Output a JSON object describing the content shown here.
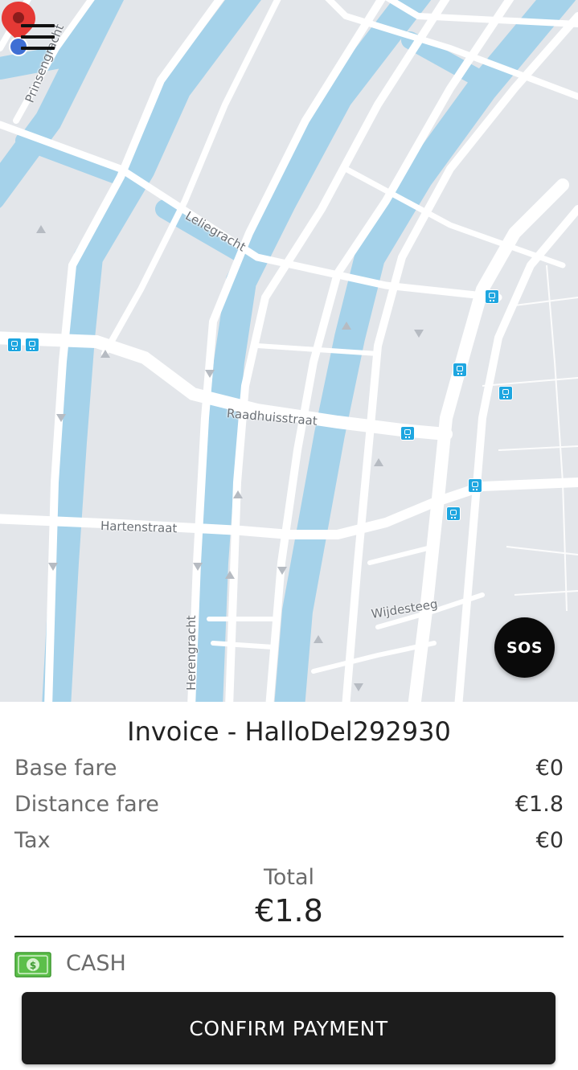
{
  "map": {
    "street_labels": {
      "prinsengracht": "Prinsengracht",
      "leliegracht": "Leliegracht",
      "raadhuisstraat": "Raadhuisstraat",
      "hartenstraat": "Hartenstraat",
      "herengracht": "Herengracht",
      "wijdesteeg": "Wijdesteeg"
    },
    "sos_label": "SOS",
    "colors": {
      "canal": "#a5d2ea",
      "road": "#ffffff",
      "land": "#e3e6ea",
      "transit": "#1ea6e0",
      "pin": "#e53935",
      "location_dot": "#3f6fd4"
    }
  },
  "invoice": {
    "title": "Invoice - HalloDel292930",
    "rows": [
      {
        "label": "Base fare",
        "value": "€0"
      },
      {
        "label": "Distance fare",
        "value": "€1.8"
      },
      {
        "label": "Tax",
        "value": "€0"
      }
    ],
    "total_label": "Total",
    "total_value": "€1.8"
  },
  "payment": {
    "method": "CASH",
    "icon": "cash-icon"
  },
  "confirm_label": "CONFIRM PAYMENT"
}
